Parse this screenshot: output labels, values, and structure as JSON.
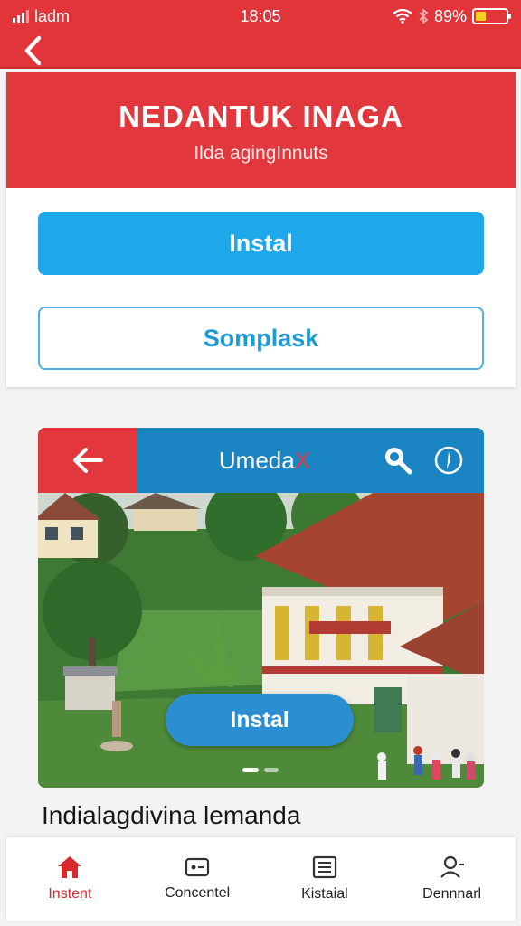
{
  "status_bar": {
    "carrier": "ladm",
    "time": "18:05",
    "battery_percent": "89%",
    "battery_level": 0.35,
    "battery_color": "#f6d21f",
    "icons": [
      "signal-icon",
      "wifi-icon",
      "bluetooth-icon",
      "battery-icon"
    ]
  },
  "header": {
    "back_icon": "chevron-left-icon",
    "title": "NEDANTUK INAGA",
    "subtitle": "Ilda agingInnuts"
  },
  "actions": {
    "primary_label": "Instal",
    "secondary_label": "Somplask"
  },
  "media": {
    "back_icon": "arrow-left-icon",
    "title": "Umeda",
    "title_suffix": "X",
    "search_icon": "search-icon",
    "compass_icon": "compass-icon",
    "overlay_button_label": "Instal",
    "pager": {
      "count": 2,
      "active": 1
    }
  },
  "caption": "Indialagdivina lemanda",
  "bottom_nav": {
    "tabs": [
      {
        "label": "Instent",
        "icon": "home-icon",
        "active": true
      },
      {
        "label": "Concentel",
        "icon": "card-icon",
        "active": false
      },
      {
        "label": "Kistaial",
        "icon": "list-icon",
        "active": false
      },
      {
        "label": "Dennnarl",
        "icon": "person-icon",
        "active": false
      }
    ]
  },
  "colors": {
    "brand_red": "#e2353a",
    "brand_blue": "#1ea7e9",
    "toolbar_blue": "#1b85c4"
  }
}
